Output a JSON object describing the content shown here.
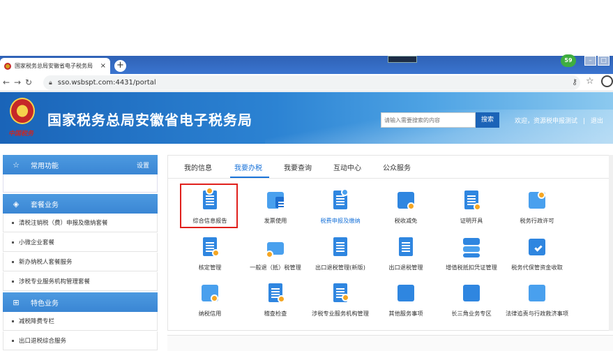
{
  "browser": {
    "tab_title": "国家税务总局安徽省电子税务局",
    "tab_close": "×",
    "new_tab": "+",
    "url": "sso.wsbspt.com:4431/portal",
    "ext_badge": "59"
  },
  "header": {
    "site_title": "国家税务总局安徽省电子税务局",
    "slogan": "中国税务",
    "search_placeholder": "请输入需要搜索的内容",
    "search_button": "搜索",
    "welcome": "欢迎，资源税申报测试",
    "divider": "|",
    "logout": "退出"
  },
  "sidebar": {
    "favorites": {
      "title": "常用功能",
      "settings": "设置"
    },
    "package": {
      "title": "套餐业务",
      "items": [
        "清税注销税（费）申报及缴纳套餐",
        "小微企业套餐",
        "新办纳税人套餐服务",
        "涉税专业服务机构管理套餐"
      ]
    },
    "special": {
      "title": "特色业务",
      "items": [
        "减税降费专栏",
        "出口退税综合服务"
      ]
    }
  },
  "main": {
    "tabs": [
      "我的信息",
      "我要办税",
      "我要查询",
      "互动中心",
      "公众服务"
    ],
    "active_tab": "我要办税",
    "tiles": [
      {
        "label": "综合信息报告",
        "icon": "report-icon"
      },
      {
        "label": "发票使用",
        "icon": "invoice-icon"
      },
      {
        "label": "税费申报及缴纳",
        "icon": "declare-icon"
      },
      {
        "label": "税收减免",
        "icon": "tax-relief-icon"
      },
      {
        "label": "证明开具",
        "icon": "certificate-icon"
      },
      {
        "label": "税务行政许可",
        "icon": "license-icon"
      },
      {
        "label": "核定管理",
        "icon": "assess-icon"
      },
      {
        "label": "一般退（抵）税管理",
        "icon": "refund-icon"
      },
      {
        "label": "出口退税管理(新版)",
        "icon": "export-refund-new-icon"
      },
      {
        "label": "出口退税管理",
        "icon": "export-refund-icon"
      },
      {
        "label": "增值税抵扣凭证管理",
        "icon": "vat-voucher-icon"
      },
      {
        "label": "税务代保管资金收取",
        "icon": "custody-icon"
      },
      {
        "label": "纳税信用",
        "icon": "credit-icon"
      },
      {
        "label": "稽查检查",
        "icon": "audit-icon"
      },
      {
        "label": "涉税专业服务机构管理",
        "icon": "agency-icon"
      },
      {
        "label": "其他服务事项",
        "icon": "other-icon"
      },
      {
        "label": "长三角业务专区",
        "icon": "yangtze-icon"
      },
      {
        "label": "法律追责与行政救济事项",
        "icon": "legal-icon"
      }
    ]
  },
  "colors": {
    "brand": "#1b63b7",
    "accent": "#1a73d9",
    "highlight": "#e0201c",
    "sidebar_head": "#3a86d4"
  }
}
